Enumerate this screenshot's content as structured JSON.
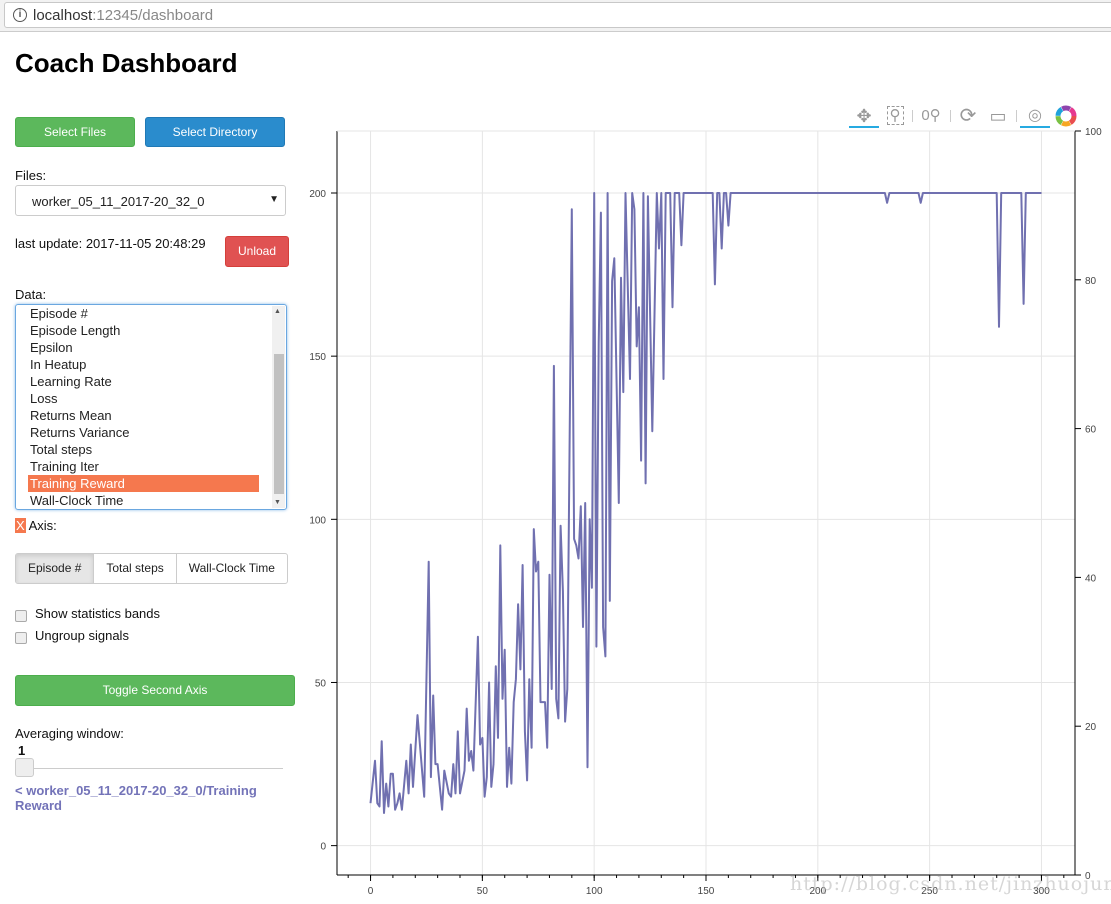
{
  "browser": {
    "host": "localhost",
    "path": ":12345/dashboard"
  },
  "title": "Coach Dashboard",
  "buttons": {
    "select_files": "Select Files",
    "select_directory": "Select Directory",
    "unload": "Unload",
    "toggle_second_axis": "Toggle Second Axis"
  },
  "files": {
    "label": "Files:",
    "selected": "worker_05_11_2017-20_32_0"
  },
  "last_update": "last update: 2017-11-05 20:48:29",
  "data": {
    "label": "Data:",
    "items": [
      "Episode #",
      "Episode Length",
      "Epsilon",
      "In Heatup",
      "Learning Rate",
      "Loss",
      "Returns Mean",
      "Returns Variance",
      "Total steps",
      "Training Iter",
      "Training Reward",
      "Wall-Clock Time"
    ],
    "selected": "Training Reward"
  },
  "x_axis": {
    "badge": "X",
    "label": "Axis:",
    "options": [
      "Episode #",
      "Total steps",
      "Wall-Clock Time"
    ],
    "selected": "Episode #"
  },
  "checkboxes": [
    {
      "label": "Show statistics bands",
      "checked": false
    },
    {
      "label": "Ungroup signals",
      "checked": false
    }
  ],
  "averaging": {
    "label": "Averaging window:",
    "value": "1"
  },
  "signal_link": "< worker_05_11_2017-20_32_0/Training Reward",
  "toolbar": [
    "pan-icon",
    "box-zoom-icon",
    "wheel-zoom-icon",
    "reset-icon",
    "save-icon",
    "crosshair-icon",
    "bokeh-logo"
  ],
  "watermark": "http://blog.csdn.net/jinzhuojun",
  "colors": {
    "line": "#7070b0",
    "selected": "#f5784e",
    "green": "#5cb85c",
    "blue": "#2a8ccd",
    "red": "#e05252"
  },
  "chart_data": {
    "type": "line",
    "xlim": [
      -15,
      315
    ],
    "ylim": [
      -9,
      219
    ],
    "y2lim": [
      0,
      100
    ],
    "x_ticks": [
      "0",
      "50",
      "100",
      "150",
      "200",
      "250",
      "300"
    ],
    "y_ticks": [
      "0",
      "50",
      "100",
      "150",
      "200"
    ],
    "y2_ticks": [
      "0",
      "20",
      "40",
      "60",
      "80",
      "100"
    ],
    "grid": true,
    "series": [
      {
        "name": "worker_05_11_2017-20_32_0/Training Reward",
        "x": [
          0,
          2,
          3,
          4,
          5,
          6,
          7,
          8,
          9,
          10,
          11,
          12,
          13,
          14,
          16,
          17,
          18,
          19,
          21,
          24,
          26,
          27,
          28,
          29,
          30,
          32,
          33,
          35,
          36,
          37,
          38,
          39,
          40,
          42,
          43,
          44,
          45,
          46,
          48,
          49,
          50,
          51,
          52,
          53,
          54,
          55,
          56,
          57,
          58,
          59,
          60,
          61,
          62,
          63,
          64,
          65,
          66,
          67,
          68,
          69,
          70,
          71,
          72,
          73,
          74,
          75,
          76,
          78,
          79,
          80,
          81,
          82,
          83,
          84,
          85,
          86,
          87,
          88,
          90,
          91,
          92,
          93,
          94,
          95,
          96,
          97,
          98,
          99,
          100,
          101,
          102,
          103,
          104,
          105,
          106,
          107,
          108,
          109,
          111,
          112,
          113,
          114,
          116,
          117,
          118,
          119,
          120,
          121,
          122,
          123,
          124,
          126,
          128,
          129,
          130,
          131,
          132,
          134,
          135,
          136,
          138,
          139,
          140,
          153,
          154,
          155,
          156,
          157,
          158,
          159,
          160,
          161,
          230,
          231,
          232,
          245,
          246,
          247,
          280,
          281,
          282,
          291,
          292,
          293,
          300
        ],
        "y": [
          13,
          26,
          13,
          12,
          32,
          10,
          19,
          12,
          22,
          22,
          11,
          13,
          16,
          11,
          26,
          16,
          31,
          18,
          40,
          15,
          87,
          21,
          46,
          25,
          25,
          11,
          23,
          16,
          15,
          25,
          16,
          35,
          16,
          23,
          42,
          26,
          29,
          23,
          64,
          31,
          33,
          15,
          21,
          50,
          18,
          25,
          55,
          33,
          92,
          45,
          60,
          18,
          30,
          19,
          44,
          51,
          74,
          54,
          86,
          35,
          20,
          51,
          30,
          97,
          84,
          87,
          44,
          44,
          30,
          83,
          48,
          147,
          45,
          39,
          98,
          78,
          38,
          48,
          195,
          94,
          92,
          88,
          104,
          67,
          105,
          24,
          100,
          79,
          200,
          61,
          154,
          194,
          67,
          58,
          200,
          75,
          173,
          180,
          105,
          174,
          139,
          200,
          143,
          200,
          195,
          153,
          165,
          118,
          200,
          111,
          199,
          127,
          200,
          183,
          200,
          143,
          200,
          200,
          165,
          200,
          200,
          184,
          200,
          200,
          172,
          200,
          200,
          183,
          200,
          200,
          190,
          200,
          200,
          197,
          200,
          200,
          197,
          200,
          200,
          159,
          200,
          200,
          166,
          200,
          200
        ]
      }
    ]
  }
}
